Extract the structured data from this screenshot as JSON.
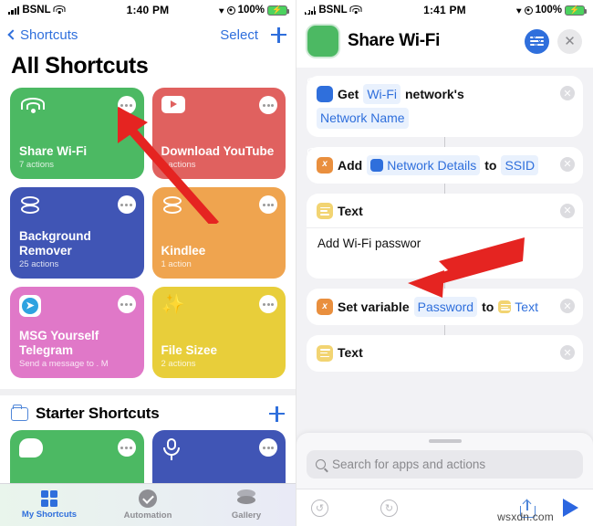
{
  "left": {
    "status": {
      "carrier": "BSNL",
      "time": "1:40 PM",
      "battery_pct": "100%",
      "wifi_icon": "wifi-icon",
      "signal_icon": "signal-bars-icon",
      "location_icon": "location-arrow-icon",
      "battery_icon": "battery-charging-icon"
    },
    "nav": {
      "back_label": "Shortcuts",
      "select_label": "Select",
      "add_label": "+"
    },
    "page_title": "All Shortcuts",
    "tiles": [
      {
        "name": "Share Wi-Fi",
        "sub": "7 actions",
        "color": "#4cb963",
        "icon": "wifi-icon"
      },
      {
        "name": "Download YouTube",
        "sub": "3 actions",
        "color": "#e0615f",
        "icon": "youtube-play-icon"
      },
      {
        "name": "Background Remover",
        "sub": "25 actions",
        "color": "#4055b5",
        "icon": "layers-icon"
      },
      {
        "name": "Kindlee",
        "sub": "1 action",
        "color": "#efa44f",
        "icon": "layers-icon"
      },
      {
        "name": "MSG Yourself Telegram",
        "sub": "Send a message to . M",
        "color": "#e078c8",
        "icon": "telegram-icon"
      },
      {
        "name": "File Sizee",
        "sub": "2 actions",
        "color": "#e8ce3a",
        "icon": "magic-wand-icon"
      }
    ],
    "section": {
      "title": "Starter Shortcuts",
      "folder_icon": "folder-icon",
      "add_label": "+"
    },
    "starter_tiles": [
      {
        "color": "#4cb963",
        "icon": "chat-bubble-icon"
      },
      {
        "color": "#4055b5",
        "icon": "microphone-icon"
      }
    ],
    "tabs": [
      {
        "label": "My Shortcuts",
        "icon": "grid-icon",
        "active": true
      },
      {
        "label": "Automation",
        "icon": "clock-check-icon",
        "active": false
      },
      {
        "label": "Gallery",
        "icon": "layers-icon",
        "active": false
      }
    ]
  },
  "right": {
    "status": {
      "carrier": "BSNL",
      "time": "1:41 PM",
      "battery_pct": "100%"
    },
    "header": {
      "title": "Share Wi-Fi",
      "app_icon": "wifi-icon",
      "settings_icon": "sliders-icon",
      "close_icon": "close-x-icon"
    },
    "actions": [
      {
        "id": "get-wifi-network",
        "icon": "wifi-icon",
        "icon_color": "#2f6fdc",
        "parts": [
          {
            "t": "text",
            "v": "Get"
          },
          {
            "t": "token",
            "v": "Wi-Fi"
          },
          {
            "t": "text",
            "v": "network's"
          },
          {
            "t": "token",
            "v": "Network Name"
          }
        ]
      },
      {
        "id": "add-network-details",
        "icon": "variable-x-icon",
        "icon_color": "#e98f3e",
        "parts": [
          {
            "t": "text",
            "v": "Add"
          },
          {
            "t": "icon-token",
            "v": "Network Details",
            "icon": "wifi-icon"
          },
          {
            "t": "text",
            "v": "to"
          },
          {
            "t": "token",
            "v": "SSID"
          }
        ]
      },
      {
        "id": "text-action",
        "icon": "text-lines-icon",
        "icon_color": "#f2d472",
        "title": "Text",
        "body": "Add Wi-Fi passwor"
      },
      {
        "id": "set-variable-password",
        "icon": "variable-x-icon",
        "icon_color": "#e98f3e",
        "parts": [
          {
            "t": "text",
            "v": "Set variable"
          },
          {
            "t": "token",
            "v": "Password"
          },
          {
            "t": "text",
            "v": "to"
          },
          {
            "t": "icon-token",
            "v": "Text",
            "icon": "text-lines-icon"
          }
        ]
      }
    ],
    "search": {
      "placeholder": "Search for apps and actions",
      "icon": "search-icon"
    },
    "toolbar": {
      "undo_icon": "undo-icon",
      "redo_icon": "redo-icon",
      "share_icon": "share-icon",
      "play_icon": "play-icon"
    },
    "watermark": "wsxdn.com"
  }
}
